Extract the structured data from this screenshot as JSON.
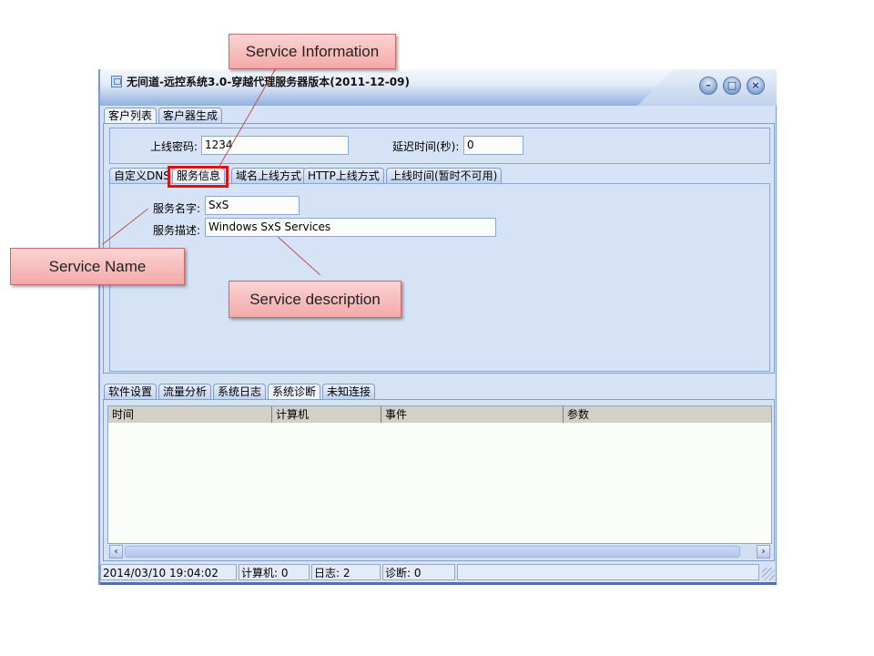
{
  "window": {
    "title": "无间道-远控系统3.0-穿越代理服务器版本(2011-12-09)",
    "icon": "app-window-icon",
    "controls": [
      {
        "name": "minimize",
        "glyph": "–"
      },
      {
        "name": "maximize",
        "glyph": "□"
      },
      {
        "name": "close",
        "glyph": "×"
      }
    ]
  },
  "top_tabs": [
    {
      "label": "客户列表",
      "active": true
    },
    {
      "label": "客户器生成",
      "active": false
    }
  ],
  "settings": {
    "password_label": "上线密码:",
    "password_value": "1234",
    "delay_label": "延迟时间(秒):",
    "delay_value": "0"
  },
  "config_tabs": [
    {
      "label": "自定义DNS",
      "active": false
    },
    {
      "label": "服务信息",
      "active": true
    },
    {
      "label": "域名上线方式",
      "active": false
    },
    {
      "label": "HTTP上线方式",
      "active": false
    },
    {
      "label": "上线时间(暂时不可用)",
      "active": false
    }
  ],
  "service": {
    "name_label": "服务名字:",
    "name_value": "SxS",
    "desc_label": "服务描述:",
    "desc_value": "Windows SxS Services"
  },
  "bottom_tabs": [
    {
      "label": "软件设置",
      "active": false
    },
    {
      "label": "流量分析",
      "active": false
    },
    {
      "label": "系统日志",
      "active": false
    },
    {
      "label": "系统诊断",
      "active": true
    },
    {
      "label": "未知连接",
      "active": false
    }
  ],
  "log_table": {
    "columns": [
      "时间",
      "计算机",
      "事件",
      "参数"
    ],
    "rows": []
  },
  "status_bar": {
    "datetime": "2014/03/10 19:04:02",
    "computers": "计算机: 0",
    "logs": "日志: 2",
    "diagnostics": "诊断: 0",
    "extra": ""
  },
  "annotations": {
    "service_information": "Service Information",
    "service_name": "Service Name",
    "service_description": "Service description",
    "color": "#f4a9a9",
    "highlight_color": "#e01010"
  }
}
